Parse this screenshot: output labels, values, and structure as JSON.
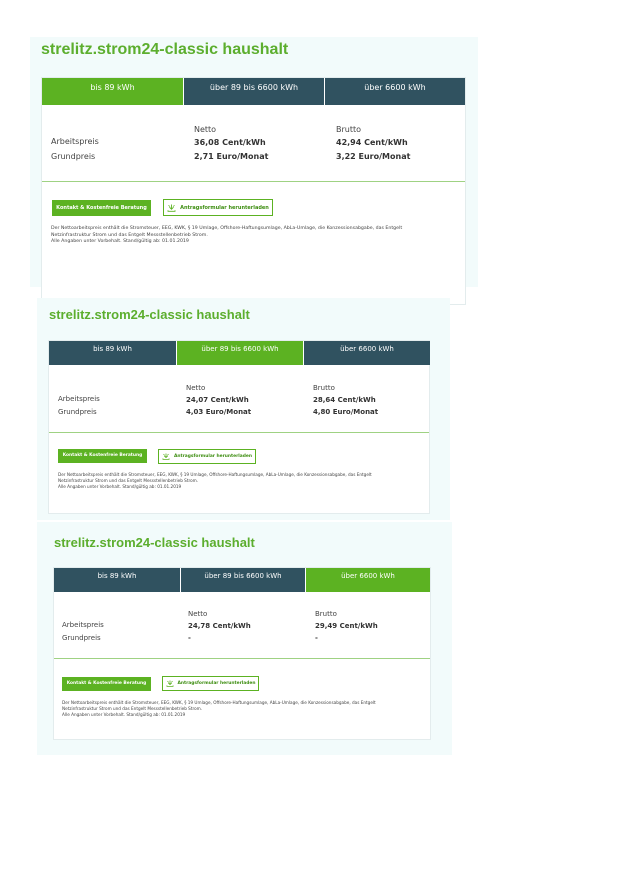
{
  "colors": {
    "accent": "#5cb222",
    "tab_dark": "#305260",
    "panel_bg": "#f2fbfb",
    "title": "#5cae2e"
  },
  "tariffs": [
    {
      "title": "strelitz.strom24-classic haushalt",
      "tabs": [
        "bis 89 kWh",
        "über 89 bis 6600 kWh",
        "über 6600 kWh"
      ],
      "active_tab": 0,
      "netto_label": "Netto",
      "brutto_label": "Brutto",
      "arbeitspreis_label": "Arbeitspreis",
      "grundpreis_label": "Grundpreis",
      "arbeitspreis_netto": "36,08 Cent/kWh",
      "grundpreis_netto": "2,71 Euro/Monat",
      "arbeitspreis_brutto": "42,94 Cent/kWh",
      "grundpreis_brutto": "3,22 Euro/Monat",
      "contact_button": "Kontakt & Kostenfreie Beratung",
      "download_button": "Antragsformular herunterladen",
      "icon": "download-icon",
      "note_lines": [
        "Der Nettoarbeitspreis enthält die Stromsteuer, EEG, KWK, § 19 Umlage, Offshore-Haftungsumlage, AbLa-Umlage, die Konzessionsabgabe, das Entgelt",
        "Netzinfrastruktur Strom und das Entgelt Messstellenbetrieb Strom.",
        "Alle Angaben unter Vorbehalt. Stand/gültig ab: 01.01.2019"
      ]
    },
    {
      "title": "strelitz.strom24-classic haushalt",
      "tabs": [
        "bis 89 kWh",
        "über 89 bis 6600 kWh",
        "über 6600 kWh"
      ],
      "active_tab": 1,
      "netto_label": "Netto",
      "brutto_label": "Brutto",
      "arbeitspreis_label": "Arbeitspreis",
      "grundpreis_label": "Grundpreis",
      "arbeitspreis_netto": "24,07 Cent/kWh",
      "grundpreis_netto": "4,03 Euro/Monat",
      "arbeitspreis_brutto": "28,64 Cent/kWh",
      "grundpreis_brutto": "4,80 Euro/Monat",
      "contact_button": "Kontakt & Kostenfreie Beratung",
      "download_button": "Antragsformular herunterladen",
      "icon": "download-icon",
      "note_lines": [
        "Der Nettoarbeitspreis enthält die Stromsteuer, EEG, KWK, § 19 Umlage, Offshore-Haftungsumlage, AbLa-Umlage, die Konzessionsabgabe, das Entgelt",
        "Netzinfrastruktur Strom und das Entgelt Messstellenbetrieb Strom.",
        "Alle Angaben unter Vorbehalt. Stand/gültig ab: 01.01.2019"
      ]
    },
    {
      "title": "strelitz.strom24-classic haushalt",
      "tabs": [
        "bis 89 kWh",
        "über 89 bis 6600 kWh",
        "über 6600 kWh"
      ],
      "active_tab": 2,
      "netto_label": "Netto",
      "brutto_label": "Brutto",
      "arbeitspreis_label": "Arbeitspreis",
      "grundpreis_label": "Grundpreis",
      "arbeitspreis_netto": "24,78 Cent/kWh",
      "grundpreis_netto": "-",
      "arbeitspreis_brutto": "29,49 Cent/kWh",
      "grundpreis_brutto": "-",
      "contact_button": "Kontakt & Kostenfreie Beratung",
      "download_button": "Antragsformular herunterladen",
      "icon": "download-icon",
      "note_lines": [
        "Der Nettoarbeitspreis enthält die Stromsteuer, EEG, KWK, § 19 Umlage, Offshore-Haftungsumlage, AbLa-Umlage, die Konzessionsabgabe, das Entgelt",
        "Netzinfrastruktur Strom und das Entgelt Messstellenbetrieb Strom.",
        "Alle Angaben unter Vorbehalt. Stand/gültig ab: 01.01.2019"
      ]
    }
  ]
}
